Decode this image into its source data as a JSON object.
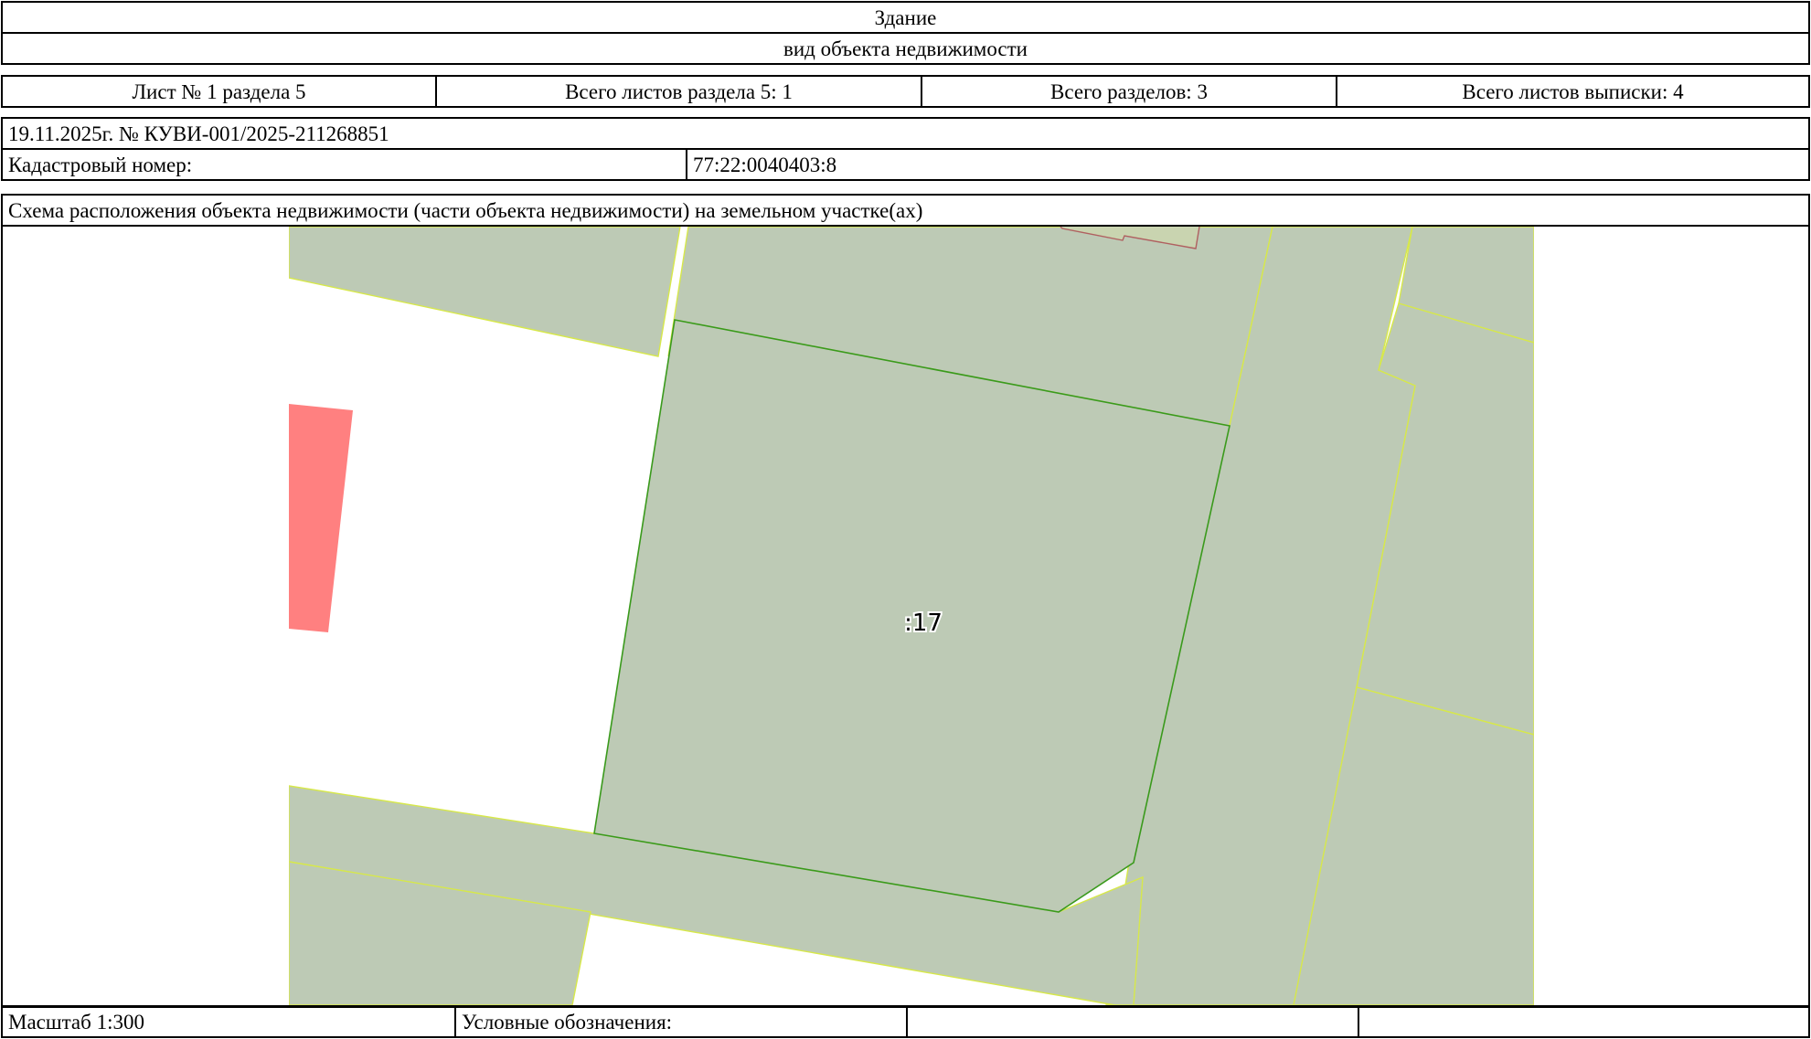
{
  "header": {
    "object_type": "Здание",
    "object_kind_label": "вид объекта недвижимости"
  },
  "sheet_info": {
    "sheet_label": "Лист № 1 раздела 5",
    "total_sheets_section": "Всего листов раздела 5: 1",
    "total_sections": "Всего разделов: 3",
    "total_sheets_extract": "Всего листов выписки: 4"
  },
  "extract": {
    "date_number": "19.11.2025г. № КУВИ-001/2025-211268851",
    "cadastral_label": "Кадастровый номер:",
    "cadastral_number": "77:22:0040403:8"
  },
  "scheme": {
    "title": "Схема расположения объекта недвижимости (части объекта недвижимости) на земельном участке(ах)",
    "parcel_label": ":17",
    "colors": {
      "parcel_fill": "#bdcab5",
      "neighbor_border": "#d7e84a",
      "main_border": "#3a9a1c",
      "building_fill": "#ff8080",
      "building_border": "#b06060"
    }
  },
  "footer": {
    "scale": "Масштаб 1:300",
    "legend_label": "Условные обозначения:",
    "legend_cell_1": "",
    "legend_cell_2": ""
  }
}
